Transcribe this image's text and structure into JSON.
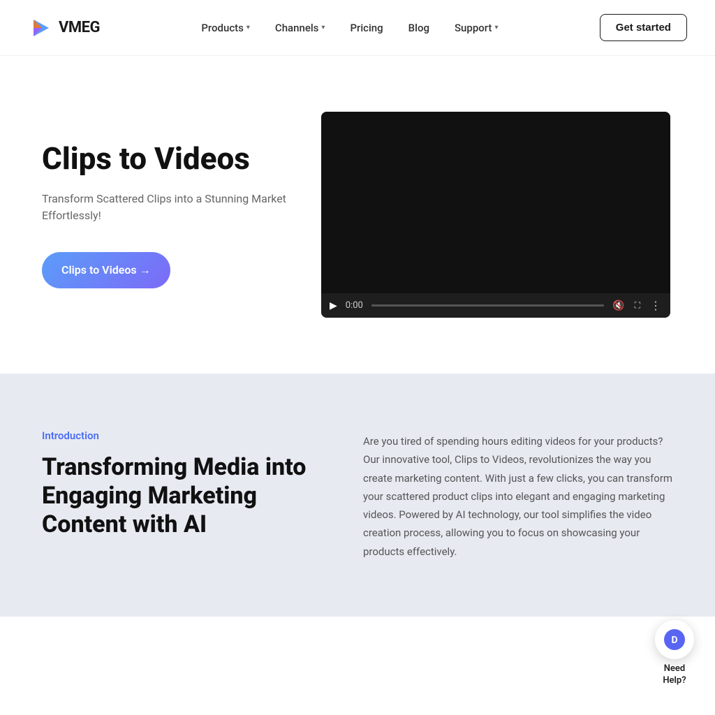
{
  "logo": {
    "text": "VMEG"
  },
  "nav": {
    "links": [
      {
        "label": "Products",
        "hasDropdown": true
      },
      {
        "label": "Channels",
        "hasDropdown": true
      },
      {
        "label": "Pricing",
        "hasDropdown": false
      },
      {
        "label": "Blog",
        "hasDropdown": false
      },
      {
        "label": "Support",
        "hasDropdown": true
      }
    ],
    "cta_label": "Get started"
  },
  "hero": {
    "title": "Clips to Videos",
    "subtitle": "Transform Scattered Clips into a Stunning Market Effortlessly!",
    "cta_label": "Clips to Videos →",
    "video": {
      "time": "0:00"
    }
  },
  "intro": {
    "label": "Introduction",
    "heading": "Transforming Media into Engaging Marketing Content with AI",
    "body": "Are you tired of spending hours editing videos for your products? Our innovative tool, Clips to Videos, revolutionizes the way you create marketing content. With just a few clicks, you can transform your scattered product clips into elegant and engaging marketing videos. Powered by AI technology, our tool simplifies the video creation process, allowing you to focus on showcasing your products effectively."
  },
  "help": {
    "label": "Need\nHelp?"
  }
}
